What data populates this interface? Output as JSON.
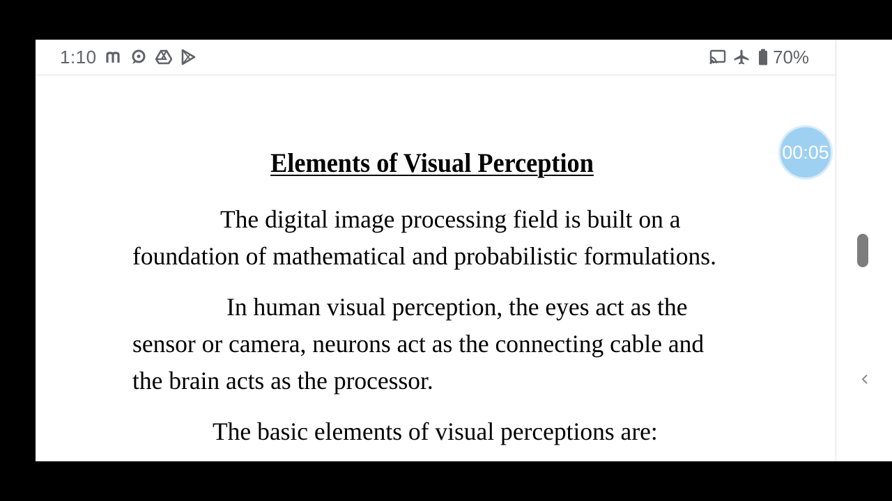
{
  "status_bar": {
    "time": "1:10",
    "battery": "70%",
    "left_icons": [
      "m-icon",
      "chat-icon",
      "drive-icon",
      "play-store-icon"
    ],
    "right_icons": [
      "cast-icon",
      "airplane-icon",
      "battery-icon"
    ]
  },
  "timer": {
    "label": "00:05"
  },
  "document": {
    "title": "Elements of Visual Perception",
    "paragraphs": [
      "The digital image processing field is built on a foundation of mathematical and probabilistic formulations.",
      "In human visual perception, the eyes act as the sensor or camera, neurons act as the connecting cable and the brain acts as the processor.",
      "The basic elements of visual perceptions are:"
    ]
  },
  "colors": {
    "background": "#000000",
    "page": "#ffffff",
    "status_text": "#5f6368",
    "timer_bubble": "#9ed0f2"
  }
}
